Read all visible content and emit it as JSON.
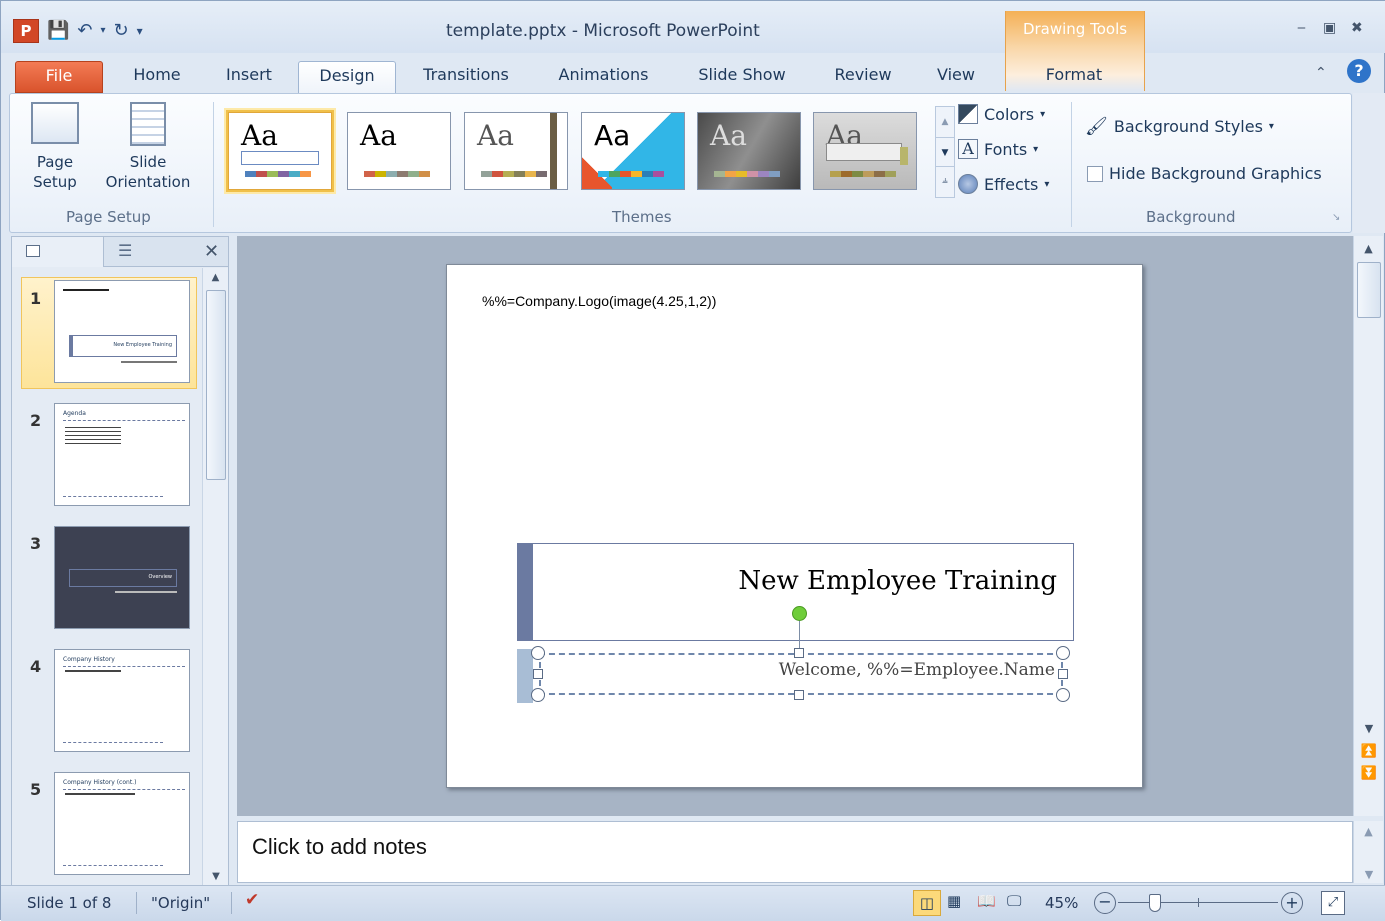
{
  "window": {
    "title": "template.pptx - Microsoft PowerPoint",
    "contextual_tab_group": "Drawing Tools"
  },
  "qat": {
    "app_icon": "P"
  },
  "tabs": [
    {
      "label": "File"
    },
    {
      "label": "Home"
    },
    {
      "label": "Insert"
    },
    {
      "label": "Design"
    },
    {
      "label": "Transitions"
    },
    {
      "label": "Animations"
    },
    {
      "label": "Slide Show"
    },
    {
      "label": "Review"
    },
    {
      "label": "View"
    },
    {
      "label": "Format"
    }
  ],
  "ribbon": {
    "page_setup": {
      "page_setup_label": "Page\nSetup",
      "slide_orientation_label": "Slide\nOrientation",
      "group_label": "Page Setup"
    },
    "themes": {
      "group_label": "Themes",
      "aa": "Aa"
    },
    "theme_options": {
      "colors": "Colors",
      "fonts": "Fonts",
      "effects": "Effects"
    },
    "background": {
      "styles": "Background Styles",
      "hide": "Hide Background Graphics",
      "group_label": "Background"
    }
  },
  "slides": [
    {
      "number": "1",
      "title": "New Employee Training"
    },
    {
      "number": "2",
      "title": "Agenda"
    },
    {
      "number": "3",
      "title": "Overview"
    },
    {
      "number": "4",
      "title": "Company History"
    },
    {
      "number": "5",
      "title": "Company History (cont.)"
    }
  ],
  "current_slide": {
    "logo_placeholder": "%%=Company.Logo(image(4.25,1,2))",
    "title": "New Employee Training",
    "subtitle": "Welcome, %%=Employee.Name"
  },
  "notes": {
    "placeholder": "Click to add notes"
  },
  "status": {
    "slide_info": "Slide 1 of 8",
    "theme": "\"Origin\"",
    "zoom": "45%"
  },
  "colors": {
    "file_tab": "#d9532c",
    "accent": "#6b7aa1",
    "drawing_tools": "#f4b056"
  }
}
